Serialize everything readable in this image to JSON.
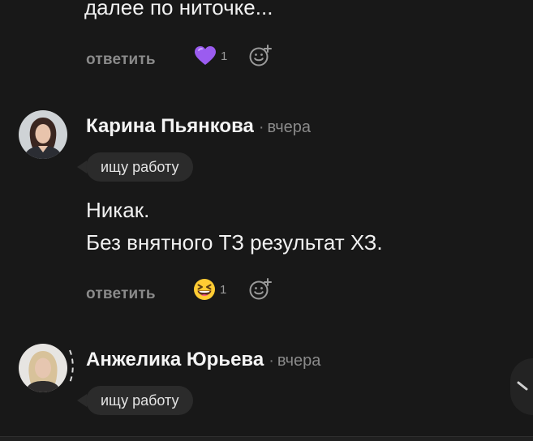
{
  "comments": [
    {
      "text_tail": "далее по ниточке...",
      "reply_label": "ответить",
      "reaction": {
        "icon": "purple-heart-emoji",
        "count": "1"
      }
    },
    {
      "author": "Карина Пьянкова",
      "time": "вчера",
      "badge": "ищу работу",
      "lines": [
        "Никак.",
        "Без внятного ТЗ результат ХЗ."
      ],
      "reply_label": "ответить",
      "reaction": {
        "icon": "grinning-squinting-emoji",
        "count": "1"
      }
    },
    {
      "author": "Анжелика Юрьева",
      "time": "вчера",
      "badge": "ищу работу"
    }
  ],
  "separator": "·",
  "colors": {
    "background": "#181818",
    "muted": "#8a8a8a",
    "badge_bg": "#2b2b2b",
    "heart": "#9b5cf0"
  }
}
